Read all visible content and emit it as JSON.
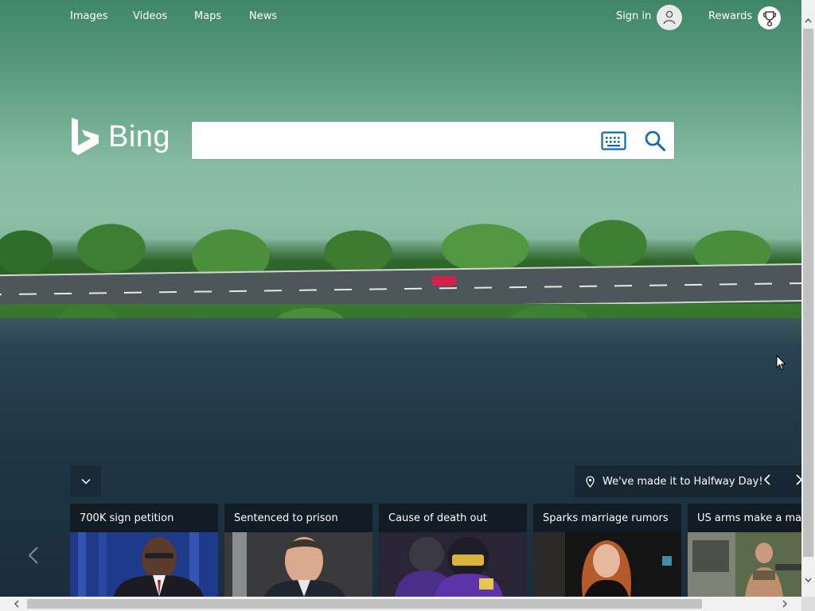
{
  "nav": {
    "links": [
      "Images",
      "Videos",
      "Maps",
      "News"
    ],
    "sign_in": "Sign in",
    "rewards": "Rewards"
  },
  "logo": {
    "text": "Bing"
  },
  "search": {
    "value": "",
    "placeholder": ""
  },
  "info_bar": {
    "text": "We've made it to Halfway Day!"
  },
  "cards": [
    {
      "title": "700K sign petition"
    },
    {
      "title": "Sentenced to prison"
    },
    {
      "title": "Cause of death out"
    },
    {
      "title": "Sparks marriage rumors"
    },
    {
      "title": "US arms make a mark"
    }
  ],
  "icons": {
    "avatar": "person-icon",
    "rewards": "trophy-icon",
    "keyboard": "keyboard-icon",
    "search": "search-icon",
    "collapse": "chevron-down-icon",
    "location": "location-pin-icon"
  },
  "colors": {
    "bing_blue": "#0c6aa6",
    "text_white": "#ffffff"
  }
}
